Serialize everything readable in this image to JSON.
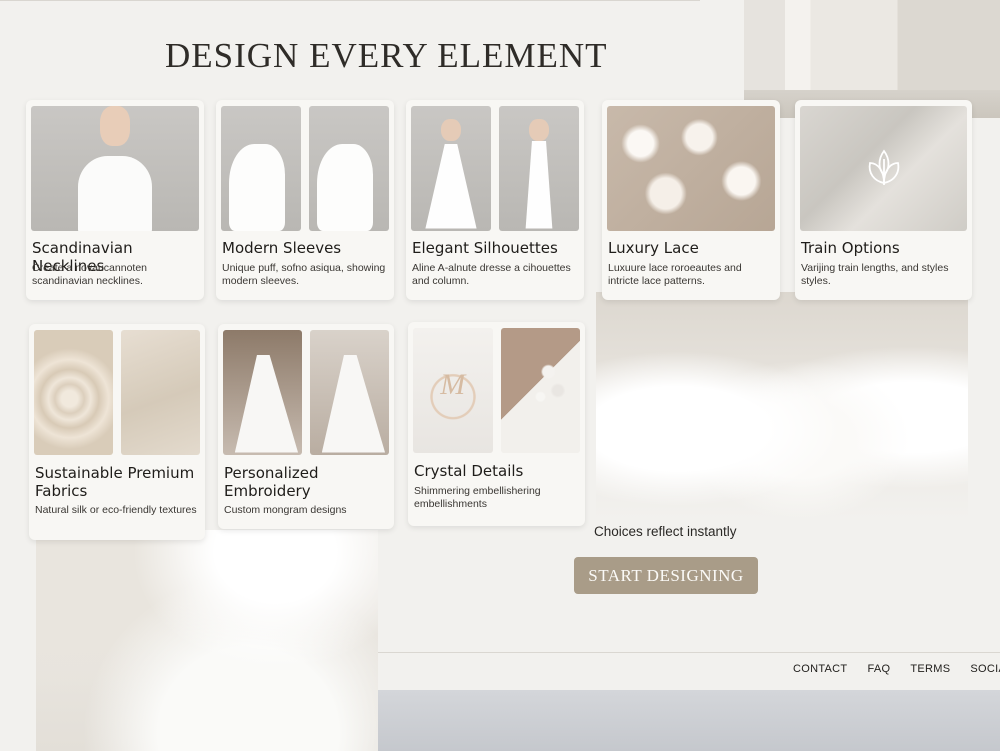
{
  "hero": {
    "headline": "DESIGN EVERY ELEMENT"
  },
  "cards": [
    {
      "title": "Scandinavian Necklines",
      "desc": "Create a novaucannoten scandinavian necklines."
    },
    {
      "title": "Modern Sleeves",
      "desc": "Unique puff, sofno asiqua, showing modern sleeves."
    },
    {
      "title": "Elegant Silhouettes",
      "desc": "Aline A-alnute dresse a cihouettes and column."
    },
    {
      "title": "Luxury Lace",
      "desc": "Luxuure lace roroeautes and intricte lace patterns."
    },
    {
      "title": "Train Options",
      "desc": "Varijing train lengths, and styles styles."
    },
    {
      "title": "Sustainable Premium Fabrics",
      "desc": "Natural silk or eco-friendly textures"
    },
    {
      "title": "Personalized Embroidery",
      "desc": "Custom mongram designs"
    },
    {
      "title": "Crystal Details",
      "desc": "Shimmering embellishering embellishments"
    }
  ],
  "monogram": "M",
  "status_text": "Choices reflect instantly",
  "cta_label": "START DESIGNING",
  "footer": {
    "links": [
      "CONTACT",
      "FAQ",
      "TERMS",
      "SOCIALS"
    ]
  },
  "colors": {
    "accent": "#a99c88",
    "background": "#f2f1ee",
    "card": "#f8f7f4"
  },
  "icons": {
    "train_card": "leaf-icon"
  }
}
